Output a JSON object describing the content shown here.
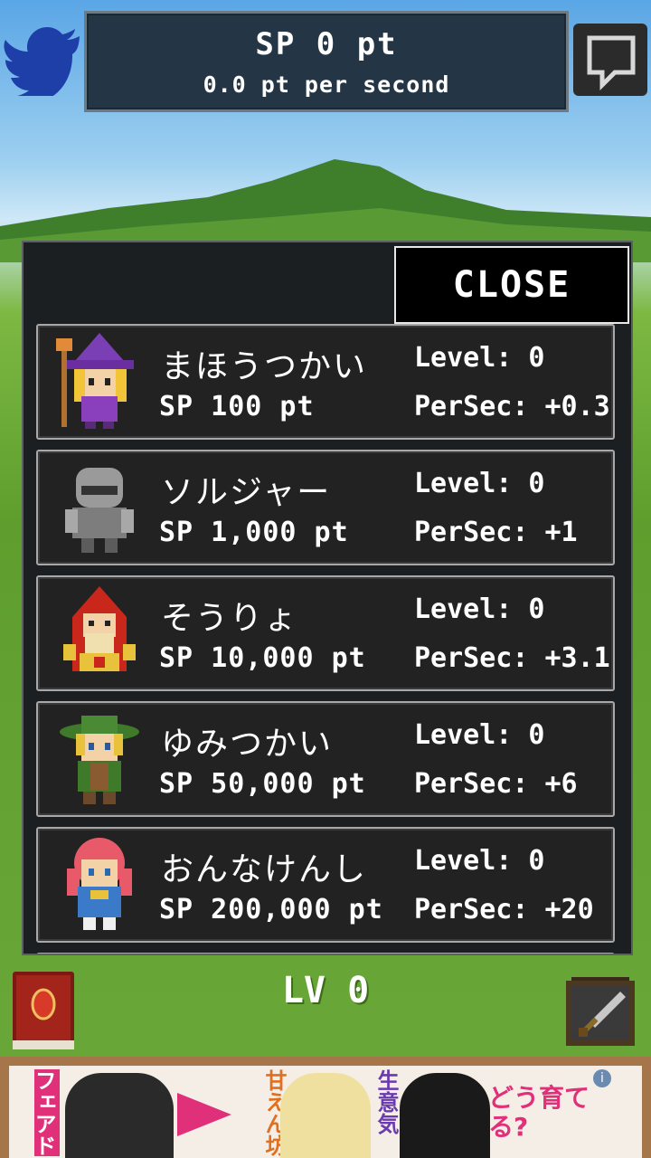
{
  "header": {
    "sp_total": "SP 0 pt",
    "sp_rate": "0.0 pt per second"
  },
  "dialog": {
    "close_label": "CLOSE",
    "units": [
      {
        "name": "まほうつかい",
        "cost": "SP 100 pt",
        "level": "Level: 0",
        "persec": "PerSec: +0.3",
        "icon": "witch-icon"
      },
      {
        "name": "ソルジャー",
        "cost": "SP 1,000 pt",
        "level": "Level: 0",
        "persec": "PerSec: +1",
        "icon": "soldier-icon"
      },
      {
        "name": "そうりょ",
        "cost": "SP 10,000 pt",
        "level": "Level: 0",
        "persec": "PerSec: +3.1",
        "icon": "priest-icon"
      },
      {
        "name": "ゆみつかい",
        "cost": "SP 50,000 pt",
        "level": "Level: 0",
        "persec": "PerSec: +6",
        "icon": "archer-icon"
      },
      {
        "name": "おんなけんし",
        "cost": "SP 200,000 pt",
        "level": "Level: 0",
        "persec": "PerSec: +20",
        "icon": "swordswoman-icon"
      }
    ]
  },
  "footer": {
    "level_label": "LV 0"
  },
  "ad": {
    "texts": [
      "フェアドル",
      "甘えん坊",
      "生意気",
      "どう育てる?"
    ]
  },
  "colors": {
    "panel": "#243645",
    "dialog": "#1c1f22",
    "row_border": "#a8a8a8",
    "twitter": "#1f3fa8"
  }
}
